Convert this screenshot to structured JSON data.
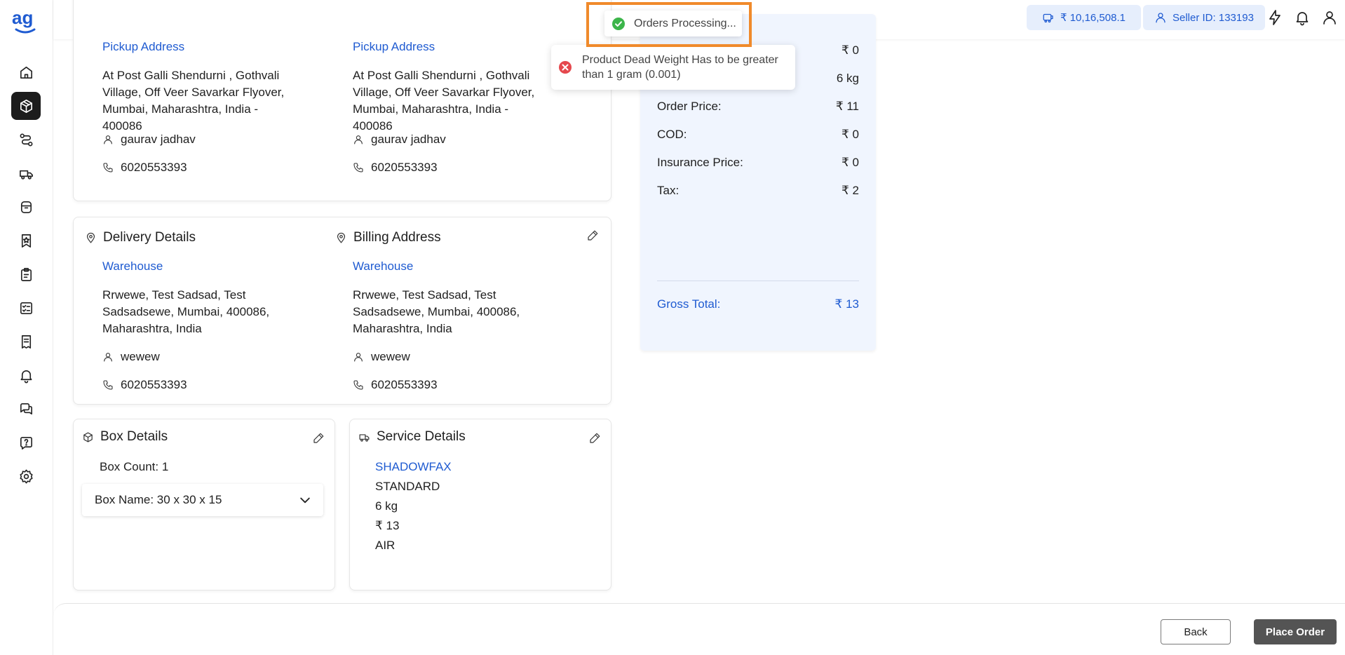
{
  "header": {
    "wallet_balance": "₹ 10,16,508.1",
    "seller_id": "Seller ID: 133193"
  },
  "toasts": {
    "success": "Orders Processing...",
    "error": "Product Dead Weight Has to be greater than 1 gram (0.001)"
  },
  "pickup": {
    "left": {
      "label": "Pickup Address",
      "address": "At Post Galli Shendurni , Gothvali Village, Off Veer Savarkar Flyover, Mumbai, Maharashtra, India - 400086",
      "name": "gaurav jadhav",
      "phone": "6020553393"
    },
    "right": {
      "label": "Pickup Address",
      "address": "At Post Galli Shendurni , Gothvali Village, Off Veer Savarkar Flyover, Mumbai, Maharashtra, India - 400086",
      "name": "gaurav jadhav",
      "phone": "6020553393"
    }
  },
  "delivery": {
    "title": "Delivery Details",
    "label": "Warehouse",
    "address": "Rrwewe, Test Sadsad, Test Sadsadsewe, Mumbai, 400086, Maharashtra, India",
    "name": "wewew",
    "phone": "6020553393"
  },
  "billing": {
    "title": "Billing Address",
    "label": "Warehouse",
    "address": "Rrwewe, Test Sadsad, Test Sadsadsewe, Mumbai, 400086, Maharashtra, India",
    "name": "wewew",
    "phone": "6020553393"
  },
  "summary": {
    "rows": [
      {
        "label": "",
        "value": "₹ 0"
      },
      {
        "label": "",
        "value": "6 kg"
      },
      {
        "label": "Order Price:",
        "value": "₹ 11"
      },
      {
        "label": "COD:",
        "value": "₹ 0"
      },
      {
        "label": "Insurance Price:",
        "value": "₹ 0"
      },
      {
        "label": "Tax:",
        "value": "₹ 2"
      }
    ],
    "gross_label": "Gross Total:",
    "gross_value": "₹ 13"
  },
  "box": {
    "title": "Box Details",
    "count": "Box Count: 1",
    "name": "Box Name: 30 x 30 x 15"
  },
  "service": {
    "title": "Service Details",
    "courier": "SHADOWFAX",
    "type": "STANDARD",
    "weight": "6 kg",
    "price": "₹ 13",
    "mode": "AIR"
  },
  "footer": {
    "back": "Back",
    "place_order": "Place Order"
  },
  "colors": {
    "accent": "#1f5bd1",
    "highlight": "#f08a2b",
    "summary_bg": "#f0f5fe",
    "success": "#3cb54a",
    "error": "#e5484d"
  }
}
